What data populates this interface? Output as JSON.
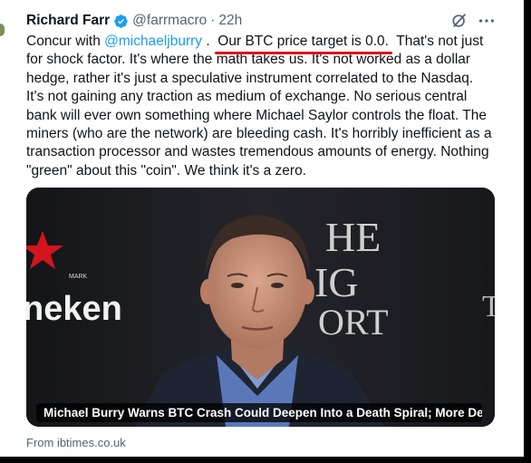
{
  "author": {
    "name": "Richard Farr",
    "handle": "@farrmacro",
    "separator": "·",
    "time": "22h",
    "verified_icon": "verified-badge-icon"
  },
  "actions": {
    "grok_icon": "grok-icon",
    "more_icon": "more-options-icon"
  },
  "tweet": {
    "line1_a": "Concur with ",
    "line1_mention": "@michaeljburry",
    "line1_b": " .  ",
    "line1_highlight": "Our BTC price target is 0.0.",
    "line1_c": "  That's not just",
    "line2": "for shock factor.  It's where the math takes us.  It's not worked as a dollar",
    "line3": "hedge, rather it's just a speculative instrument correlated to the Nasdaq.",
    "line4": "It's not gaining any traction as medium of exchange.  No serious central",
    "line5": "bank will ever own something where Michael Saylor controls the float.  The",
    "line6": "miners (who are the network) are bleeding cash.  It's horribly inefficient as a",
    "line7": "transaction processor and wastes tremendous amounts of energy.  Nothing",
    "line8": "\"green\" about this \"coin\".  We think it's a zero."
  },
  "card": {
    "backdrop_left": "neken",
    "backdrop_left_small": "MARK",
    "backdrop_right_1": "HE",
    "backdrop_right_2": "IG",
    "backdrop_right_3": "ORT",
    "backdrop_far_right": "T",
    "headline": "Michael Burry Warns BTC Crash Could Deepen Into a Death Spiral; More Decli...",
    "source": "From ibtimes.co.uk"
  },
  "colors": {
    "link": "#1d9bf0",
    "verified": "#1d9bf0",
    "underline": "#e0101a",
    "muted": "#536471"
  }
}
